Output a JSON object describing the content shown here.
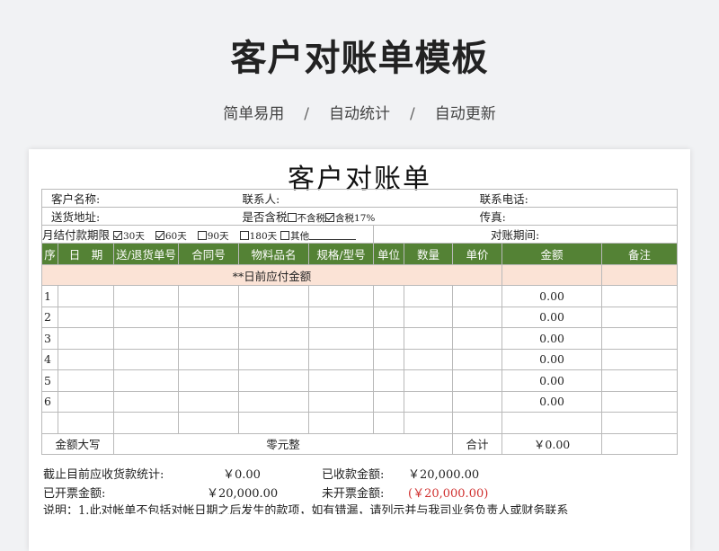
{
  "hero": {
    "title": "客户对账单模板",
    "tags": [
      "简单易用",
      "自动统计",
      "自动更新"
    ],
    "separator": "/"
  },
  "sheet": {
    "title": "客户对账单",
    "info": {
      "customer_label": "客户名称:",
      "contact_label": "联系人:",
      "phone_label": "联系电话:",
      "address_label": "送货地址:",
      "tax_label": "是否含税",
      "tax_options": [
        {
          "label": "不含税",
          "checked": false
        },
        {
          "label": "含税17%",
          "checked": true
        }
      ],
      "fax_label": "传真:",
      "payment_label": "月结付款期限",
      "payment_options": [
        {
          "label": "30天",
          "checked": true
        },
        {
          "label": "60天",
          "checked": true
        },
        {
          "label": "90天",
          "checked": false
        },
        {
          "label": "180天",
          "checked": false
        },
        {
          "label": "其他",
          "checked": false
        }
      ],
      "period_label": "对账期间:"
    },
    "headers": [
      "序",
      "日　期",
      "送/退货单号",
      "合同号",
      "物料品名",
      "规格/型号",
      "单位",
      "数量",
      "单价",
      "金额",
      "备注"
    ],
    "previous_balance_label": "**日前应付金额",
    "rows": [
      {
        "no": "1",
        "amount": "0.00"
      },
      {
        "no": "2",
        "amount": "0.00"
      },
      {
        "no": "3",
        "amount": "0.00"
      },
      {
        "no": "4",
        "amount": "0.00"
      },
      {
        "no": "5",
        "amount": "0.00"
      },
      {
        "no": "6",
        "amount": "0.00"
      },
      {
        "no": "",
        "amount": ""
      }
    ],
    "total": {
      "uppercase_label": "金额大写",
      "uppercase_value": "零元整",
      "sum_label": "合计",
      "sum_value": "￥0.00"
    },
    "footer": {
      "receivable_label": "截止目前应收货款统计:",
      "receivable_value": "￥0.00",
      "received_label": "已收款金额:",
      "received_value": "￥20,000.00",
      "invoiced_label": "已开票金额:",
      "invoiced_value": "￥20,000.00",
      "uninvoiced_label": "未开票金额:",
      "uninvoiced_value": "(￥20,000.00)",
      "note": "说明：1.此对帐单不包括对帐日期之后发生的款项，如有错漏，请列示并与我司业务负责人或财务联系"
    },
    "colors": {
      "header_bg": "#548235",
      "subheader_bg": "#fbe3d6",
      "negative": "#d0302f"
    }
  }
}
